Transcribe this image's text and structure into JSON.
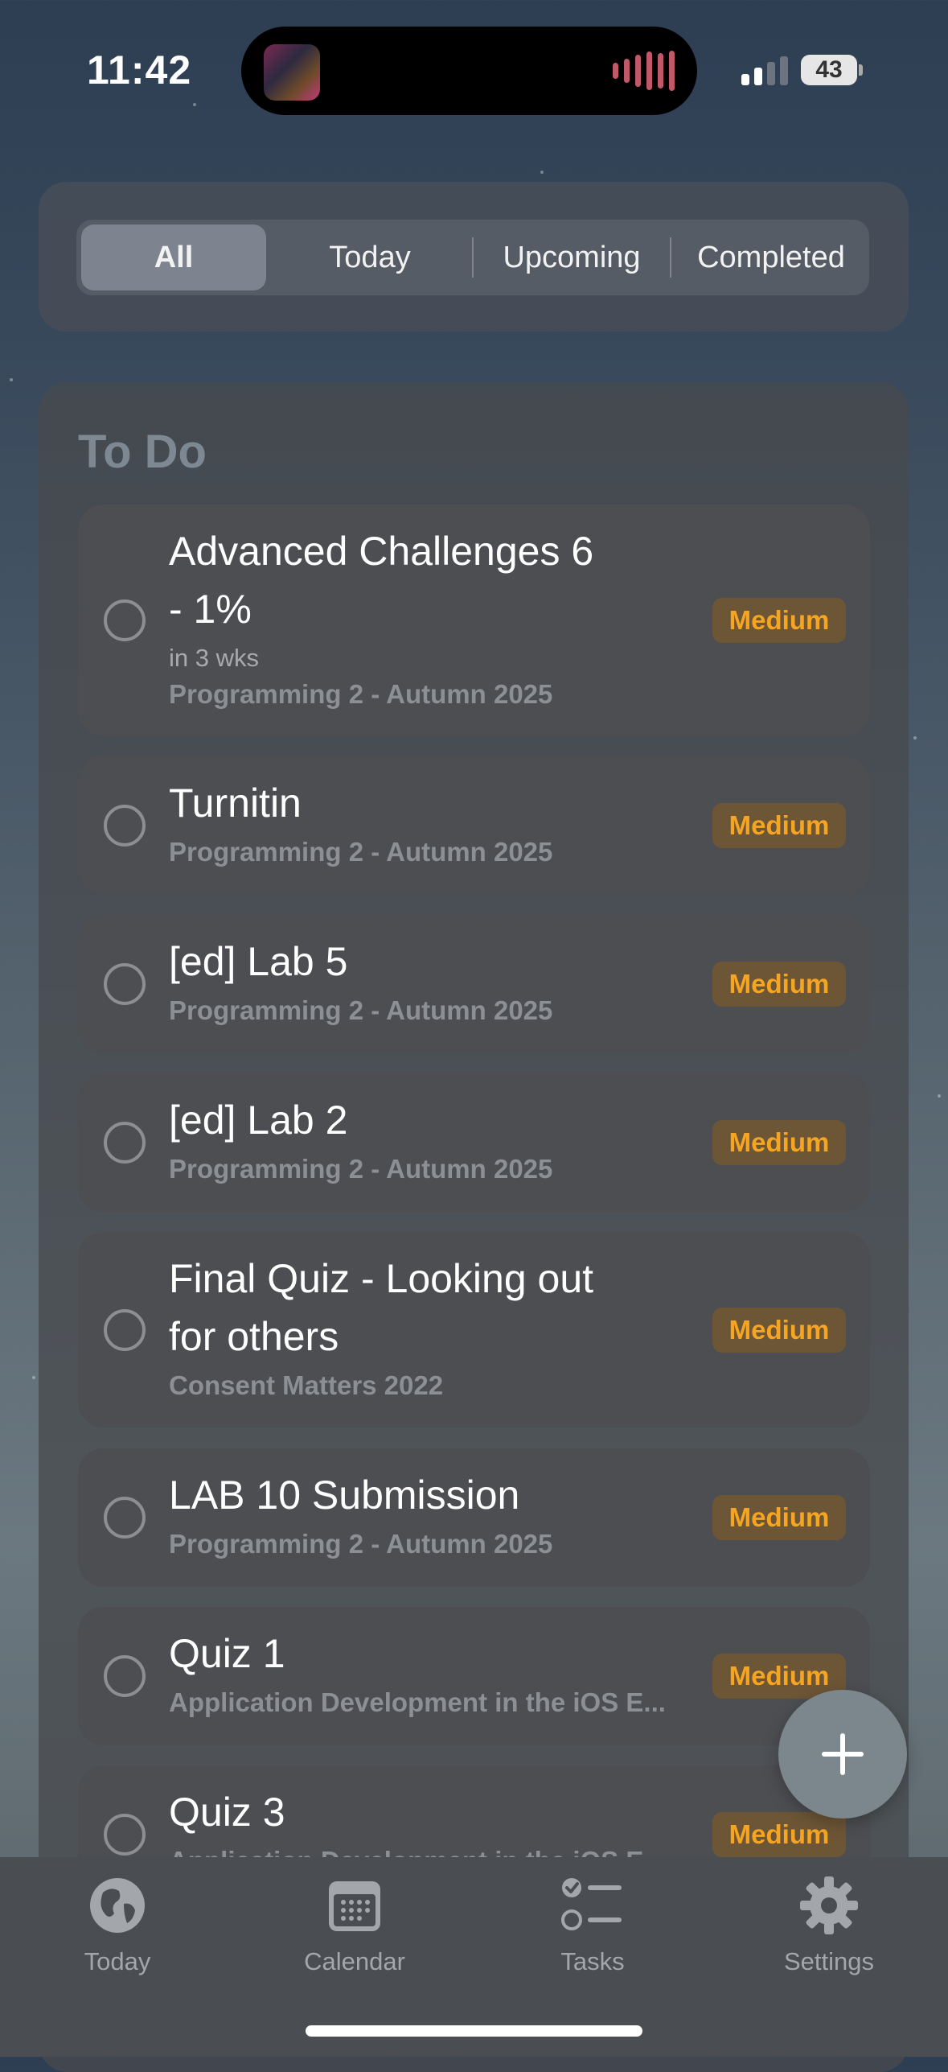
{
  "status_bar": {
    "time": "11:42",
    "battery": "43"
  },
  "filters": {
    "items": [
      "All",
      "Today",
      "Upcoming",
      "Completed"
    ],
    "selected": "All"
  },
  "section": {
    "title": "To Do"
  },
  "tasks": [
    {
      "title_line1": "Advanced Challenges 6",
      "title_line2": "- 1%",
      "due": "in 3 wks",
      "course": "Programming 2 - Autumn 2025",
      "priority": "Medium"
    },
    {
      "title_line1": "Turnitin",
      "course": "Programming 2 - Autumn 2025",
      "priority": "Medium"
    },
    {
      "title_line1": "[ed] Lab 5",
      "course": "Programming 2 - Autumn 2025",
      "priority": "Medium"
    },
    {
      "title_line1": "[ed] Lab 2",
      "course": "Programming 2 - Autumn 2025",
      "priority": "Medium"
    },
    {
      "title_line1": "Final Quiz - Looking out",
      "title_line2": "for others",
      "course": "Consent Matters 2022",
      "priority": "Medium"
    },
    {
      "title_line1": "LAB 10 Submission",
      "course": "Programming 2 - Autumn 2025",
      "priority": "Medium"
    },
    {
      "title_line1": "Quiz 1",
      "course": "Application Development in the iOS E...",
      "priority": "Medium"
    },
    {
      "title_line1": "Quiz 3",
      "course": "Application Development in the iOS E...",
      "priority": "Medium"
    }
  ],
  "tabbar": {
    "items": [
      {
        "label": "Today",
        "icon": "globe-icon"
      },
      {
        "label": "Calendar",
        "icon": "calendar-icon"
      },
      {
        "label": "Tasks",
        "icon": "checklist-icon"
      },
      {
        "label": "Settings",
        "icon": "gear-icon"
      }
    ]
  },
  "colors": {
    "priority_medium": "#f6a523",
    "accent_bg": "#2d3e53"
  }
}
